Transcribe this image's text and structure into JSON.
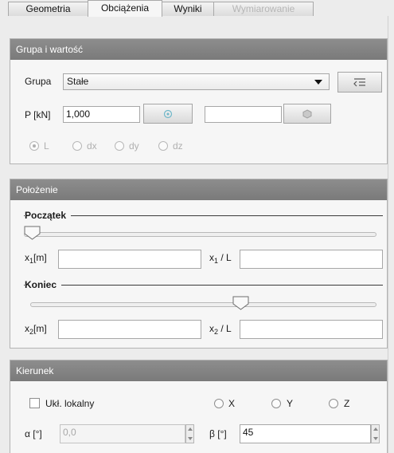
{
  "tabs": [
    {
      "label": "Geometria",
      "state": "normal"
    },
    {
      "label": "Obciążenia",
      "state": "active"
    },
    {
      "label": "Wyniki",
      "state": "normal"
    },
    {
      "label": "Wymiarowanie",
      "state": "disabled"
    }
  ],
  "group_panel": {
    "title": "Grupa i wartość",
    "group_label": "Grupa",
    "group_value": "Stałe",
    "group_button_icon": "list-arrow-icon",
    "p_label": "P [kN]",
    "p_value": "1,000",
    "p_button_icon": "snowflake-icon",
    "p2_value": "",
    "p2_button_icon": "hexagon-icon",
    "radios": [
      {
        "label": "L",
        "checked": true
      },
      {
        "label": "dx",
        "checked": false
      },
      {
        "label": "dy",
        "checked": false
      },
      {
        "label": "dz",
        "checked": false
      }
    ]
  },
  "position_panel": {
    "title": "Położenie",
    "start_title": "Początek",
    "start_slider": 0.0,
    "x1_label_main": "x",
    "x1_sub": "1",
    "x1_unit": "[m]",
    "x1_value": "",
    "x1L_label_main": "x",
    "x1L_sub": "1",
    "x1L_unit": " / L",
    "x1L_value": "",
    "end_title": "Koniec",
    "end_slider": 0.5,
    "x2_label_main": "x",
    "x2_sub": "2",
    "x2_unit": "[m]",
    "x2_value": "",
    "x2L_label_main": "x",
    "x2L_sub": "2",
    "x2L_unit": " / L",
    "x2L_value": ""
  },
  "direction_panel": {
    "title": "Kierunek",
    "local_label": "Ukł. lokalny",
    "local_checked": false,
    "axis_radios": [
      "X",
      "Y",
      "Z"
    ],
    "alpha_label": "α [°]",
    "alpha_value": "0,0",
    "beta_label": "β [°]",
    "beta_value": "45"
  },
  "colors": {
    "panel_header": "#828282",
    "active_tab": "#f6f6f6",
    "disabled_text": "#b0b0b0"
  }
}
